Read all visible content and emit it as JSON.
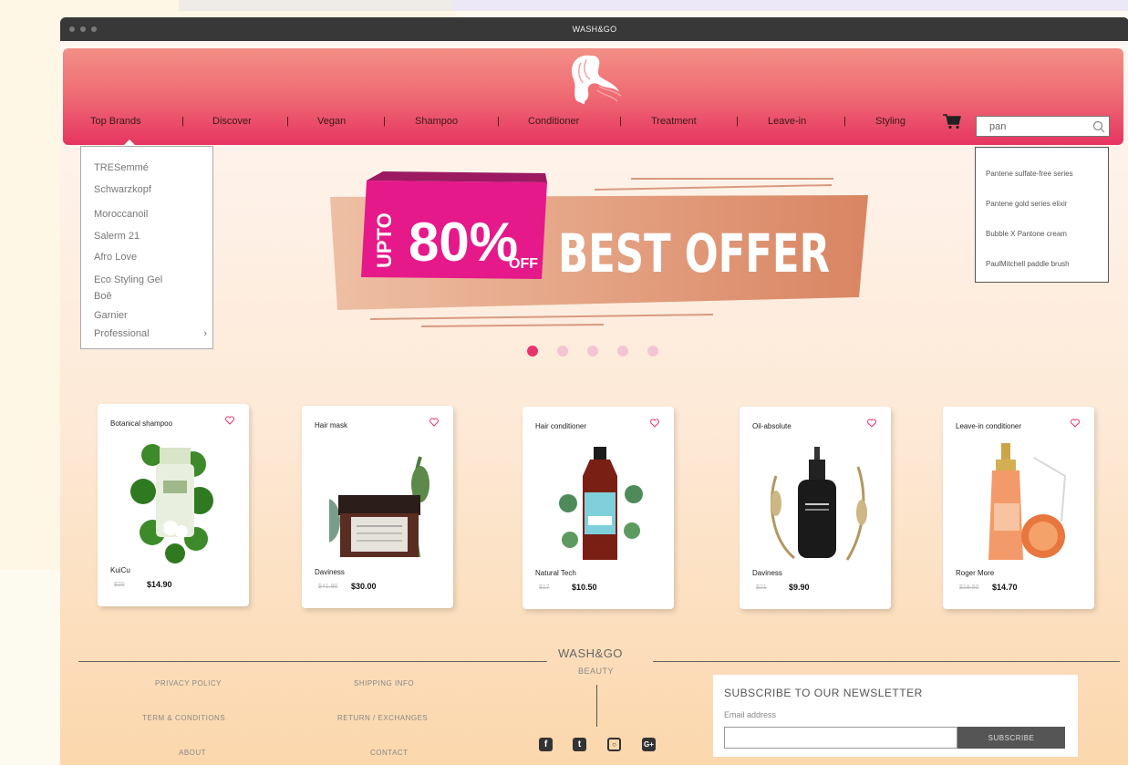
{
  "window": {
    "title": "WASH&GO"
  },
  "nav": {
    "items": [
      "Top Brands",
      "Discover",
      "Vegan",
      "Shampoo",
      "Conditioner",
      "Treatment",
      "Leave-in",
      "Styling"
    ],
    "separator": "|"
  },
  "search": {
    "value": "pan"
  },
  "brands_menu": {
    "items": [
      "TRESemmé",
      "Schwarzkopf",
      "Moroccanoil",
      "Salerm 21",
      "Afro Love",
      "Eco Styling Gel",
      "Boê",
      "Garnier",
      "Professional"
    ]
  },
  "suggestions": [
    "Pantene sulfate-free series",
    "Pantene gold series elixir",
    "Bubble X Pantone cream",
    "PaulMitchell paddle brush"
  ],
  "banner": {
    "upto": "UPTO",
    "percent": "80%",
    "off": "OFF",
    "headline": "BEST OFFER",
    "slides": 5,
    "active_slide": 1
  },
  "products": [
    {
      "title": "Botanical shampoo",
      "brand": "KuiCu",
      "old_price": "$20",
      "price": "$14.90"
    },
    {
      "title": "Hair mask",
      "brand": "Daviness",
      "old_price": "$41.90",
      "price": "$30.00"
    },
    {
      "title": "Hair conditioner",
      "brand": "Natural Tech",
      "old_price": "$17",
      "price": "$10.50"
    },
    {
      "title": "Oil-absolute",
      "brand": "Daviness",
      "old_price": "$21",
      "price": "$9.90"
    },
    {
      "title": "Leave-in conditioner",
      "brand": "Roger More",
      "old_price": "$19.50",
      "price": "$14.70"
    }
  ],
  "footer": {
    "logo": "WASH&GO",
    "tagline": "BEAUTY",
    "links": [
      "PRIVACY POLICY",
      "SHIPPING INFO",
      "TERM & CONDITIONS",
      "RETURN / EXCHANGES",
      "ABOUT",
      "CONTACT"
    ],
    "social": [
      "facebook-icon",
      "twitter-icon",
      "instagram-icon",
      "google-plus-icon"
    ],
    "newsletter": {
      "title": "SUBSCRIBE TO OUR NEWSLETTER",
      "label": "Email address",
      "button": "SUBSCRIBE"
    }
  },
  "colors": {
    "accent": "#e8336d",
    "header_top": "#f38f86",
    "header_bottom": "#e63561",
    "footer_bg": "#fbd7ac"
  }
}
